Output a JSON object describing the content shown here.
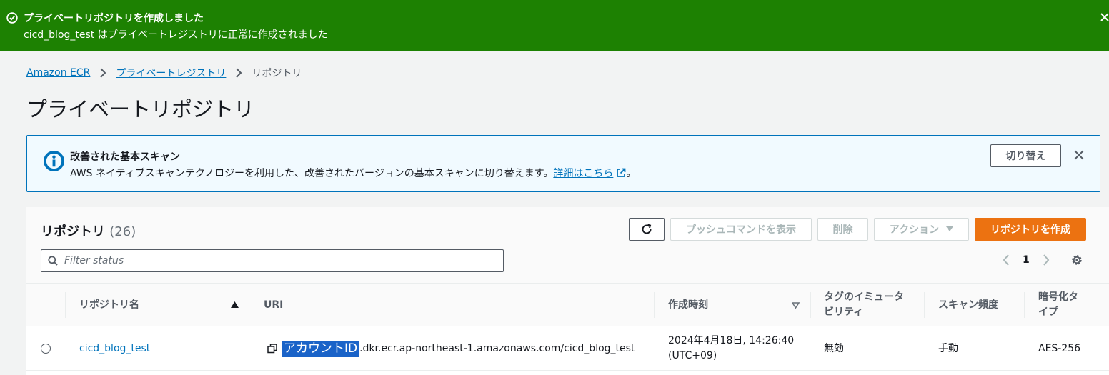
{
  "flash": {
    "title": "プライベートリポジトリを作成しました",
    "message": "cicd_blog_test はプライベートレジストリに正常に作成されました",
    "color": "#1d8102"
  },
  "breadcrumb": {
    "items": [
      "Amazon ECR",
      "プライベートレジストリ"
    ],
    "current": "リポジトリ"
  },
  "page_title": "プライベートリポジトリ",
  "info_alert": {
    "title": "改善された基本スキャン",
    "body": "AWS ネイティブスキャンテクノロジーを利用した、改善されたバージョンの基本スキャンに切り替えます。",
    "link": "詳細はこちら",
    "body_end": "。",
    "button": "切り替え"
  },
  "table": {
    "title": "リポジトリ",
    "count": "(26)",
    "buttons": {
      "push": "プッシュコマンドを表示",
      "delete": "削除",
      "action": "アクション",
      "create": "リポジトリを作成"
    },
    "filter_placeholder": "Filter status",
    "page": "1",
    "columns": [
      "リポジトリ名",
      "URI",
      "作成時刻",
      "タグのイミュータ",
      "ビリティ",
      "スキャン頻度",
      "暗号化タ",
      "イプ"
    ],
    "rows": [
      {
        "name": "cicd_blog_test",
        "uri_highlight": "アカウントID",
        "uri_rest": ".dkr.ecr.ap-northeast-1.amazonaws.com/cicd_blog_test",
        "created_1": "2024年4月18日, 14:26:40",
        "created_2": "(UTC+09)",
        "immutability": "無効",
        "scan": "手動",
        "encryption": "AES-256"
      }
    ]
  },
  "colors": {
    "accent": "#ec7211",
    "link": "#0073bb",
    "info_bg": "#f1faff"
  }
}
